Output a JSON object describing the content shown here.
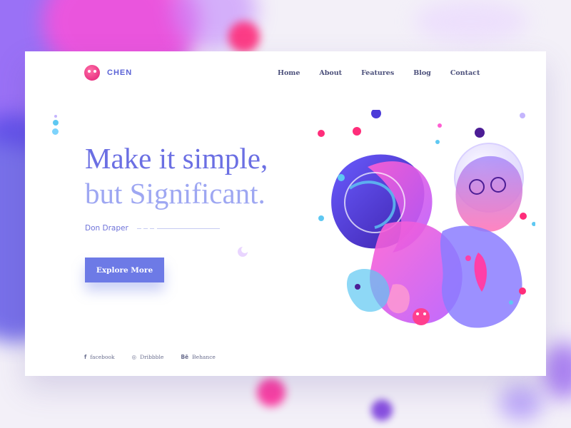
{
  "brand": {
    "name": "CHEN",
    "logo_icon": "logo-face-icon",
    "color": "#e11d74"
  },
  "nav": {
    "items": [
      "Home",
      "About",
      "Features",
      "Blog",
      "Contact"
    ]
  },
  "hero": {
    "headline_line1": "Make it simple,",
    "headline_line2": "but Significant.",
    "author": "Don Draper",
    "cta_label": "Explore More"
  },
  "social": {
    "items": [
      {
        "icon_glyph": "f",
        "icon": "facebook-icon",
        "label": "facebook"
      },
      {
        "icon_glyph": "◎",
        "icon": "dribbble-icon",
        "label": "Dribbble"
      },
      {
        "icon_glyph": "Bē",
        "icon": "behance-icon",
        "label": "Behance"
      }
    ]
  },
  "colors": {
    "accent": "#6d7ae6",
    "headline": "#6b6fe3",
    "headline_fade": "#9ea7f2",
    "pink": "#ff3fa8",
    "purple": "#7c3aed",
    "cyan": "#5ec8f2"
  }
}
